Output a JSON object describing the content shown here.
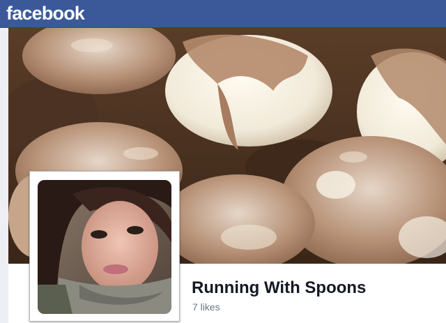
{
  "header": {
    "logo_text": "facebook",
    "bar_color": "#3b5998"
  },
  "cover": {
    "description_icon": "cover-photo"
  },
  "profile": {
    "name": "Running With Spoons",
    "likes": "7 likes"
  }
}
